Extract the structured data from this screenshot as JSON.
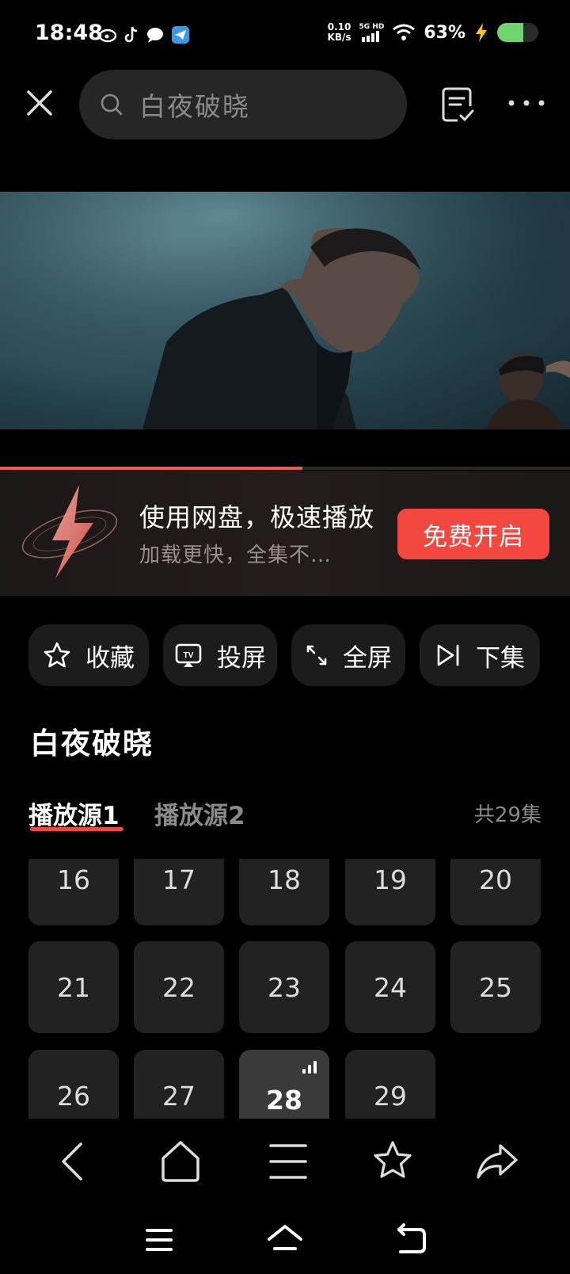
{
  "status_bar": {
    "time": "18:48",
    "net_speed_value": "0.10",
    "net_speed_unit": "KB/s",
    "signal_label_1": "5G HD",
    "battery_percent": "63%",
    "battery_level": 0.63,
    "app_icons": [
      "weibo-icon",
      "tiktok-icon",
      "message-icon",
      "telegram-icon"
    ]
  },
  "top_bar": {
    "search_text": "白夜破晓",
    "close_icon": "close-icon",
    "notes_icon": "notes-check-icon",
    "more_icon": "more-horizontal-icon"
  },
  "player": {
    "progress": 0.53
  },
  "promo": {
    "title": "使用网盘，极速播放",
    "subtitle": "加载更快，全集不…",
    "button": "免费开启"
  },
  "actions": [
    {
      "label": "收藏",
      "icon": "star-icon"
    },
    {
      "label": "投屏",
      "icon": "cast-tv-icon"
    },
    {
      "label": "全屏",
      "icon": "fullscreen-icon"
    },
    {
      "label": "下集",
      "icon": "next-episode-icon"
    }
  ],
  "title": "白夜破晓",
  "sources": {
    "tabs": [
      "播放源1",
      "播放源2"
    ],
    "active_tab": 0,
    "episode_count": "共29集"
  },
  "episodes": [
    "16",
    "17",
    "18",
    "19",
    "20",
    "21",
    "22",
    "23",
    "24",
    "25",
    "26",
    "27",
    "28",
    "29"
  ],
  "current_episode": "28",
  "bottom_nav": [
    "back-icon",
    "home-icon",
    "menu-icon",
    "favorite-star-icon",
    "share-icon"
  ],
  "system_nav": [
    "recents-menu-icon",
    "system-home-icon",
    "system-back-icon"
  ],
  "colors": {
    "accent": "#f2483f",
    "progress": "#f05a50",
    "background": "#000000",
    "tile": "#222222"
  }
}
